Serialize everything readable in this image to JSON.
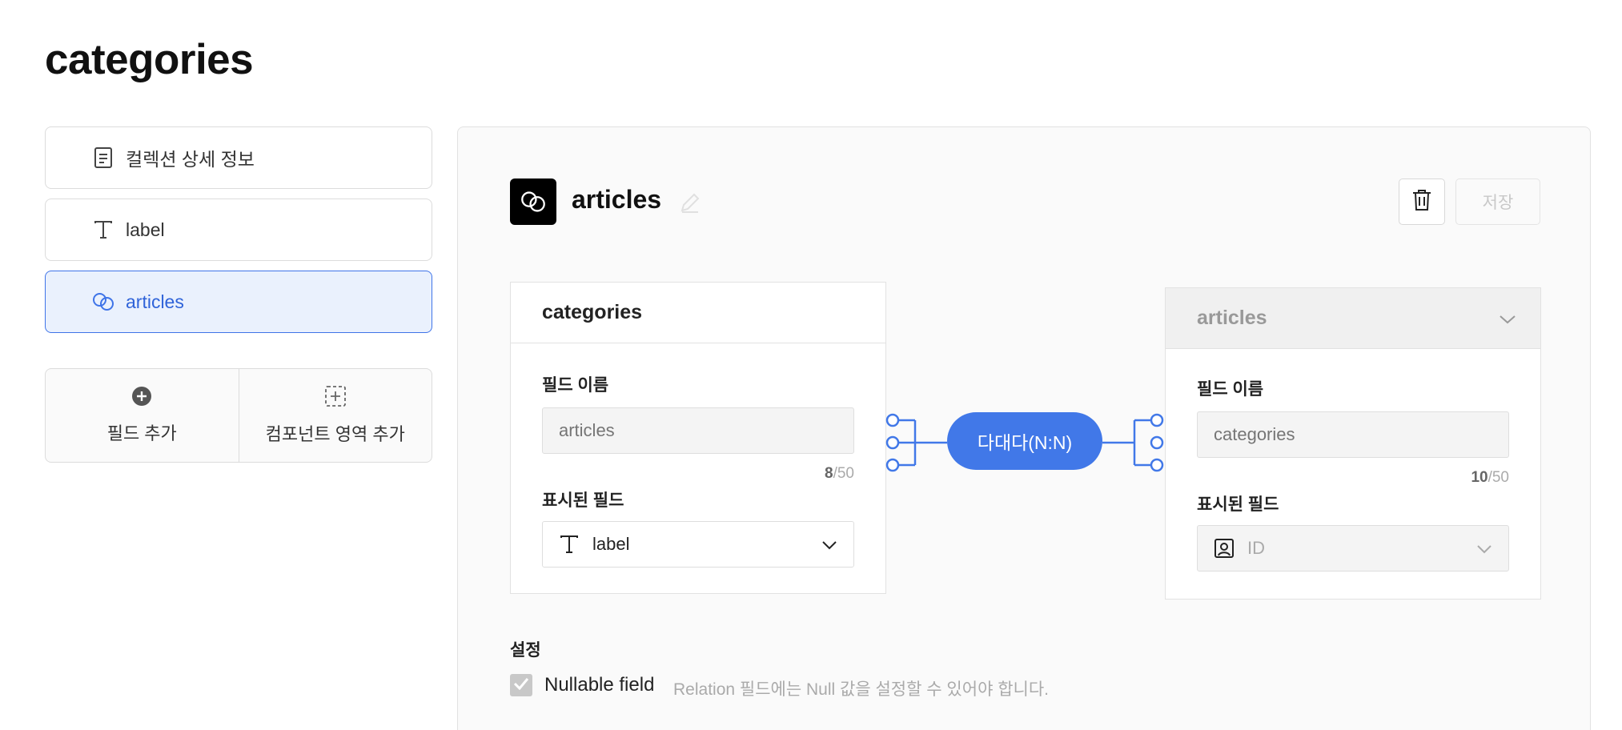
{
  "page": {
    "title": "categories"
  },
  "sidebar": {
    "items": [
      {
        "label": "컬렉션 상세 정보",
        "icon": "document-icon"
      },
      {
        "label": "label",
        "icon": "text-icon"
      },
      {
        "label": "articles",
        "icon": "link-icon",
        "active": true
      }
    ],
    "add_field_label": "필드 추가",
    "add_component_label": "컴포넌트 영역 추가"
  },
  "field": {
    "name": "articles",
    "icon": "link-icon",
    "save_label": "저장"
  },
  "relation": {
    "left": {
      "collection": "categories",
      "field_name_label": "필드 이름",
      "field_name_placeholder": "articles",
      "count_current": "8",
      "count_max": "/50",
      "display_label": "표시된 필드",
      "display_value": "label"
    },
    "type_label": "다대다(N:N)",
    "right": {
      "collection": "articles",
      "field_name_label": "필드 이름",
      "field_name_placeholder": "categories",
      "count_current": "10",
      "count_max": "/50",
      "display_label": "표시된 필드",
      "display_value": "ID"
    }
  },
  "settings": {
    "title": "설정",
    "nullable_label": "Nullable field",
    "nullable_desc": "Relation 필드에는 Null 값을 설정할 수 있어야 합니다.",
    "nullable_checked": true
  },
  "colors": {
    "accent": "#4178e8",
    "active_bg": "#eaf1fd"
  }
}
